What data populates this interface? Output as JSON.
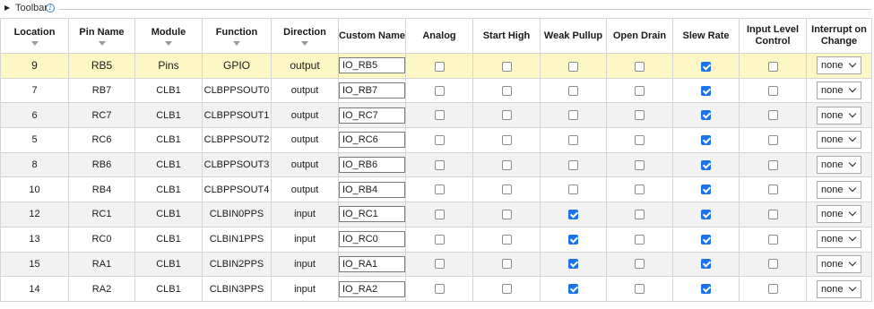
{
  "toolbar": {
    "label": "Toolbar",
    "toggle_icon": "triangle-right-icon",
    "info_icon": "info-icon",
    "info_glyph": "i"
  },
  "headers": [
    {
      "label": "Location",
      "sortable": true
    },
    {
      "label": "Pin Name",
      "sortable": true
    },
    {
      "label": "Module",
      "sortable": true
    },
    {
      "label": "Function",
      "sortable": true
    },
    {
      "label": "Direction",
      "sortable": true
    },
    {
      "label": "Custom Name",
      "sortable": false
    },
    {
      "label": "Analog",
      "sortable": false
    },
    {
      "label": "Start High",
      "sortable": false
    },
    {
      "label": "Weak Pullup",
      "sortable": false
    },
    {
      "label": "Open Drain",
      "sortable": false
    },
    {
      "label": "Slew Rate",
      "sortable": false
    },
    {
      "label": "Input Level Control",
      "sortable": false
    },
    {
      "label": "Interrupt on Change",
      "sortable": false
    }
  ],
  "rows": [
    {
      "location": "9",
      "pin": "RB5",
      "module": "Pins",
      "function": "GPIO",
      "direction": "output",
      "custom_name": "IO_RB5",
      "analog": false,
      "start_high": false,
      "weak_pullup": false,
      "open_drain": false,
      "slew_rate": true,
      "input_level": false,
      "ioc": "none",
      "selected": true
    },
    {
      "location": "7",
      "pin": "RB7",
      "module": "CLB1",
      "function": "CLBPPSOUT0",
      "direction": "output",
      "custom_name": "IO_RB7",
      "analog": false,
      "start_high": false,
      "weak_pullup": false,
      "open_drain": false,
      "slew_rate": true,
      "input_level": false,
      "ioc": "none"
    },
    {
      "location": "6",
      "pin": "RC7",
      "module": "CLB1",
      "function": "CLBPPSOUT1",
      "direction": "output",
      "custom_name": "IO_RC7",
      "analog": false,
      "start_high": false,
      "weak_pullup": false,
      "open_drain": false,
      "slew_rate": true,
      "input_level": false,
      "ioc": "none"
    },
    {
      "location": "5",
      "pin": "RC6",
      "module": "CLB1",
      "function": "CLBPPSOUT2",
      "direction": "output",
      "custom_name": "IO_RC6",
      "analog": false,
      "start_high": false,
      "weak_pullup": false,
      "open_drain": false,
      "slew_rate": true,
      "input_level": false,
      "ioc": "none"
    },
    {
      "location": "8",
      "pin": "RB6",
      "module": "CLB1",
      "function": "CLBPPSOUT3",
      "direction": "output",
      "custom_name": "IO_RB6",
      "analog": false,
      "start_high": false,
      "weak_pullup": false,
      "open_drain": false,
      "slew_rate": true,
      "input_level": false,
      "ioc": "none"
    },
    {
      "location": "10",
      "pin": "RB4",
      "module": "CLB1",
      "function": "CLBPPSOUT4",
      "direction": "output",
      "custom_name": "IO_RB4",
      "analog": false,
      "start_high": false,
      "weak_pullup": false,
      "open_drain": false,
      "slew_rate": true,
      "input_level": false,
      "ioc": "none"
    },
    {
      "location": "12",
      "pin": "RC1",
      "module": "CLB1",
      "function": "CLBIN0PPS",
      "direction": "input",
      "custom_name": "IO_RC1",
      "analog": false,
      "start_high": false,
      "weak_pullup": true,
      "open_drain": false,
      "slew_rate": true,
      "input_level": false,
      "ioc": "none"
    },
    {
      "location": "13",
      "pin": "RC0",
      "module": "CLB1",
      "function": "CLBIN1PPS",
      "direction": "input",
      "custom_name": "IO_RC0",
      "analog": false,
      "start_high": false,
      "weak_pullup": true,
      "open_drain": false,
      "slew_rate": true,
      "input_level": false,
      "ioc": "none"
    },
    {
      "location": "15",
      "pin": "RA1",
      "module": "CLB1",
      "function": "CLBIN2PPS",
      "direction": "input",
      "custom_name": "IO_RA1",
      "analog": false,
      "start_high": false,
      "weak_pullup": true,
      "open_drain": false,
      "slew_rate": true,
      "input_level": false,
      "ioc": "none"
    },
    {
      "location": "14",
      "pin": "RA2",
      "module": "CLB1",
      "function": "CLBIN3PPS",
      "direction": "input",
      "custom_name": "IO_RA2",
      "analog": false,
      "start_high": false,
      "weak_pullup": true,
      "open_drain": false,
      "slew_rate": true,
      "input_level": false,
      "ioc": "none"
    }
  ],
  "colors": {
    "selected_row": "#fdf7c6",
    "alt_row": "#f2f2f2",
    "checkbox_on": "#1a73e8",
    "grid": "#d4d4d4"
  }
}
